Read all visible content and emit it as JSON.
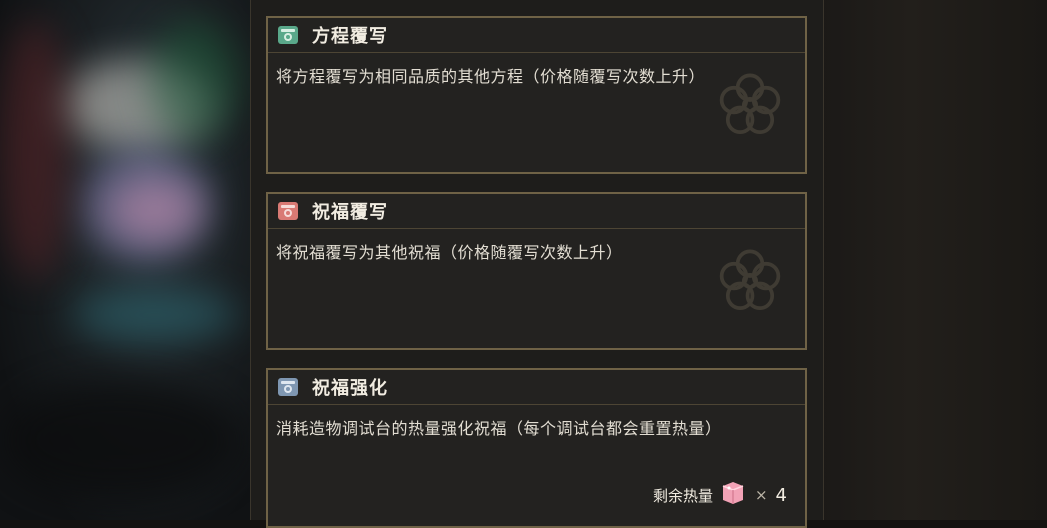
{
  "cards": [
    {
      "title": "方程覆写",
      "desc": "将方程覆写为相同品质的其他方程（价格随覆写次数上升）",
      "icon": "equation-rewrite-icon",
      "icon_color": "#5aa88a"
    },
    {
      "title": "祝福覆写",
      "desc": "将祝福覆写为其他祝福（价格随覆写次数上升）",
      "icon": "blessing-rewrite-icon",
      "icon_color": "#d97a74"
    },
    {
      "title": "祝福强化",
      "desc": "消耗造物调试台的热量强化祝福（每个调试台都会重置热量）",
      "icon": "blessing-enhance-icon",
      "icon_color": "#7f97b2"
    }
  ],
  "heat": {
    "label": "剩余热量",
    "times": "×",
    "count": "4",
    "icon": "heat-crystal-icon"
  }
}
